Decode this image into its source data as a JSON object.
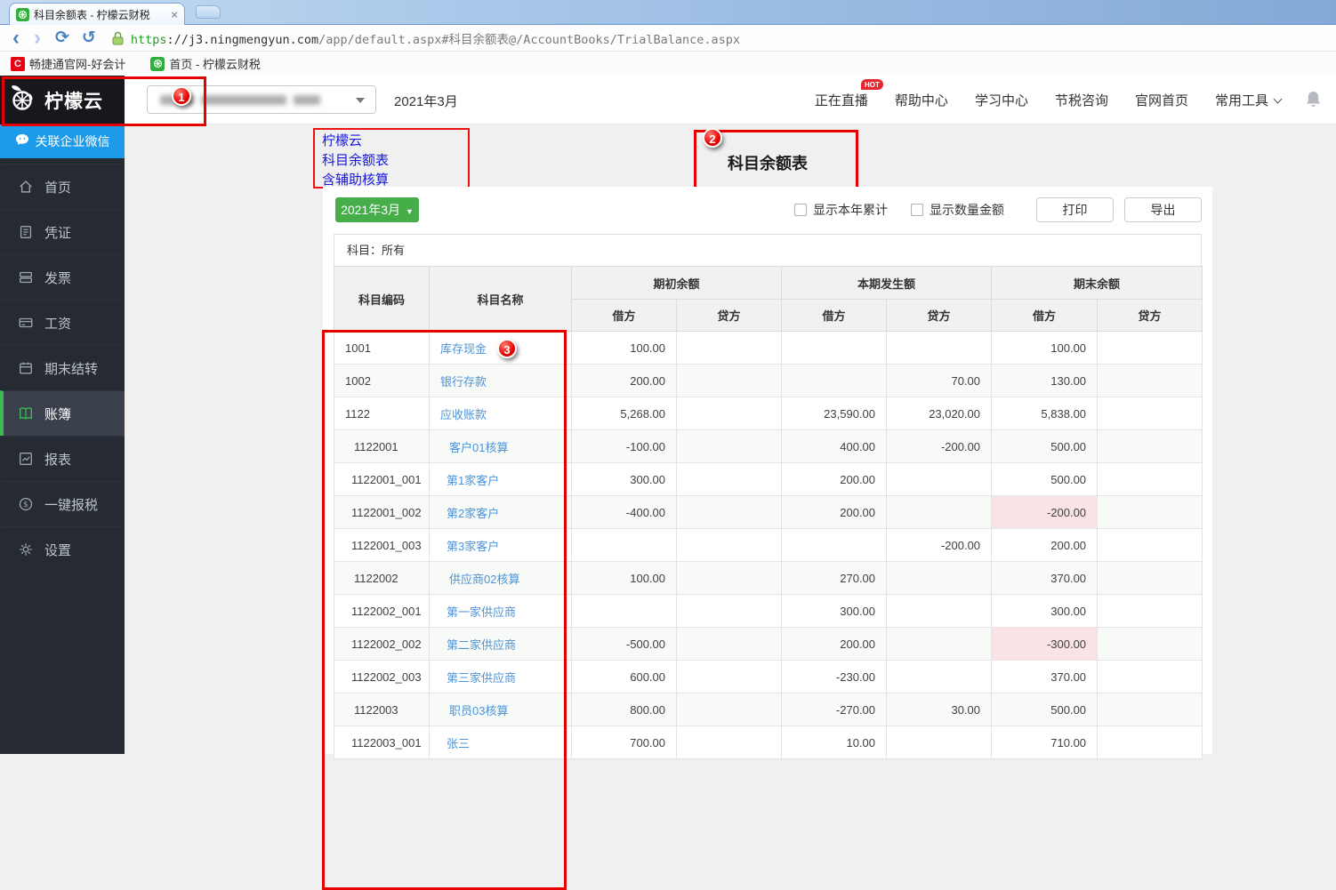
{
  "browser": {
    "tab_title": "科目余额表 - 柠檬云财税",
    "close_glyph": "×",
    "url": {
      "scheme": "https",
      "host": "://j3.ningmengyun.com",
      "path": "/app/default.aspx#科目余额表@/AccountBooks/TrialBalance.aspx"
    },
    "bookmarks": [
      {
        "label": "畅捷通官网-好会计",
        "icon_letter": "C"
      },
      {
        "label": "首页 - 柠檬云财税"
      }
    ]
  },
  "sidebar": {
    "logo_text": "柠檬云",
    "wechat_label": "关联企业微信",
    "items": [
      {
        "key": "home",
        "icon": "home-icon",
        "label": "首页",
        "active": false
      },
      {
        "key": "voucher",
        "icon": "voucher-icon",
        "label": "凭证",
        "active": false
      },
      {
        "key": "invoice",
        "icon": "invoice-icon",
        "label": "发票",
        "active": false
      },
      {
        "key": "salary",
        "icon": "salary-card-icon",
        "label": "工资",
        "active": false
      },
      {
        "key": "carryover",
        "icon": "calendar-icon",
        "label": "期末结转",
        "active": false
      },
      {
        "key": "books",
        "icon": "ledger-book-icon",
        "label": "账簿",
        "active": true
      },
      {
        "key": "report",
        "icon": "chart-icon",
        "label": "报表",
        "active": false
      },
      {
        "key": "tax",
        "icon": "dollar-circle-icon",
        "label": "一键报税",
        "active": false
      },
      {
        "key": "settings",
        "icon": "gear-icon",
        "label": "设置",
        "active": false
      }
    ]
  },
  "header": {
    "period": "2021年3月",
    "links": [
      "正在直播",
      "帮助中心",
      "学习中心",
      "节税咨询",
      "官网首页",
      "常用工具"
    ],
    "hot_badge": "HOT"
  },
  "annotations": {
    "note_lines": [
      "柠檬云",
      "科目余额表",
      "含辅助核算"
    ],
    "badge1": "1",
    "badge2": "2",
    "badge3": "3"
  },
  "main": {
    "title": "科目余额表",
    "period_button": "2021年3月",
    "checkboxes": [
      "显示本年累计",
      "显示数量金额"
    ],
    "print_label": "打印",
    "export_label": "导出",
    "filter_label": "科目：所有",
    "table": {
      "code_header": "科目编码",
      "name_header": "科目名称",
      "groups": [
        "期初余额",
        "本期发生额",
        "期末余额"
      ],
      "sub_headers": [
        "借方",
        "贷方"
      ],
      "rows": [
        {
          "code": "1001",
          "name": "库存现金",
          "level": 1,
          "cells": [
            "100.00",
            "",
            "",
            "",
            "100.00",
            ""
          ]
        },
        {
          "code": "1002",
          "name": "银行存款",
          "level": 1,
          "cells": [
            "200.00",
            "",
            "",
            "70.00",
            "130.00",
            ""
          ]
        },
        {
          "code": "1122",
          "name": "应收账款",
          "level": 1,
          "cells": [
            "5,268.00",
            "",
            "23,590.00",
            "23,020.00",
            "5,838.00",
            ""
          ]
        },
        {
          "code": "1122001",
          "name": "客户01核算",
          "level": 2,
          "cells": [
            "-100.00",
            "",
            "400.00",
            "-200.00",
            "500.00",
            ""
          ]
        },
        {
          "code": "1122001_001",
          "name": "第1家客户",
          "level": 3,
          "cells": [
            "300.00",
            "",
            "200.00",
            "",
            "500.00",
            ""
          ]
        },
        {
          "code": "1122001_002",
          "name": "第2家客户",
          "level": 3,
          "cells": [
            "-400.00",
            "",
            "200.00",
            "",
            "-200.00",
            ""
          ],
          "highlight": 4
        },
        {
          "code": "1122001_003",
          "name": "第3家客户",
          "level": 3,
          "cells": [
            "",
            "",
            "",
            "-200.00",
            "200.00",
            ""
          ]
        },
        {
          "code": "1122002",
          "name": "供应商02核算",
          "level": 2,
          "cells": [
            "100.00",
            "",
            "270.00",
            "",
            "370.00",
            ""
          ]
        },
        {
          "code": "1122002_001",
          "name": "第一家供应商",
          "level": 3,
          "cells": [
            "",
            "",
            "300.00",
            "",
            "300.00",
            ""
          ]
        },
        {
          "code": "1122002_002",
          "name": "第二家供应商",
          "level": 3,
          "cells": [
            "-500.00",
            "",
            "200.00",
            "",
            "-300.00",
            ""
          ],
          "highlight": 4
        },
        {
          "code": "1122002_003",
          "name": "第三家供应商",
          "level": 3,
          "cells": [
            "600.00",
            "",
            "-230.00",
            "",
            "370.00",
            ""
          ]
        },
        {
          "code": "1122003",
          "name": "职员03核算",
          "level": 2,
          "cells": [
            "800.00",
            "",
            "-270.00",
            "30.00",
            "500.00",
            ""
          ]
        },
        {
          "code": "1122003_001",
          "name": "张三",
          "level": 3,
          "cells": [
            "700.00",
            "",
            "10.00",
            "",
            "710.00",
            ""
          ]
        }
      ]
    }
  },
  "colors": {
    "accent_green": "#45ae49",
    "active_green": "#3bbb4e",
    "sidebar_bg": "#262b33",
    "wechat_blue": "#1b9be9",
    "link_blue": "#4c93da",
    "annotation_red": "#e60000",
    "negative_cell_pink": "#fae3e5"
  }
}
